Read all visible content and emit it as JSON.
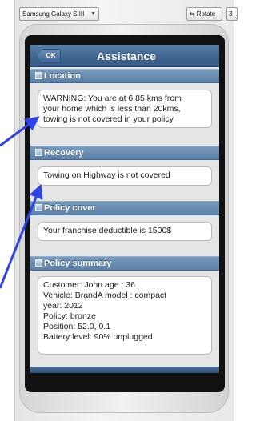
{
  "toolbar": {
    "device_label": "Samsung Galaxy S III",
    "rotate_label": "Rotate",
    "edge_label": "3"
  },
  "app": {
    "back_button": "OK",
    "title": "Assistance"
  },
  "sections": {
    "location": {
      "title": "Location",
      "lines": [
        "WARNING: You are at 6.85 kms from",
        "your home which is less than 20kms,",
        "towing is not covered in your policy"
      ]
    },
    "recovery": {
      "title": "Recovery",
      "lines": [
        "Towing on Highway is not covered"
      ]
    },
    "policy_cover": {
      "title": "Policy cover",
      "lines": [
        "Your franchise deductible is 1500$"
      ]
    },
    "policy_summary": {
      "title": "Policy summary",
      "lines": [
        "Customer: John age : 36",
        "Vehicle: BrandA model : compact",
        "year: 2012",
        "Policy: bronze",
        "Position: 52.0, 0.1",
        "Battery level: 90% unplugged"
      ]
    }
  },
  "colors": {
    "header_blue": "#3f6691",
    "section_blue": "#6a8db3",
    "annotation_arrow": "#2f44e6"
  }
}
